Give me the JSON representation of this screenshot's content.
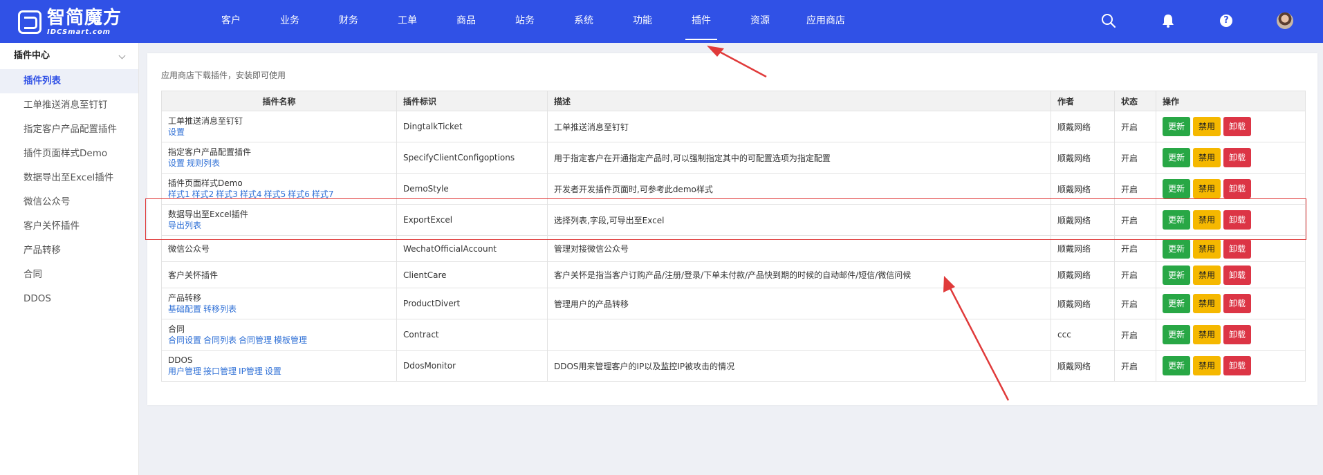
{
  "brand": {
    "name_cn": "智简魔方",
    "name_en": "IDCSmart.com"
  },
  "nav": [
    "客户",
    "业务",
    "财务",
    "工单",
    "商品",
    "站务",
    "系统",
    "功能",
    "插件",
    "资源",
    "应用商店"
  ],
  "nav_active": "插件",
  "header_icons": [
    "search-icon",
    "bell-icon",
    "help-icon",
    "avatar"
  ],
  "help_glyph": "?",
  "sidebar": {
    "group": "插件中心",
    "items": [
      "插件列表",
      "工单推送消息至钉钉",
      "指定客户产品配置插件",
      "插件页面样式Demo",
      "数据导出至Excel插件",
      "微信公众号",
      "客户关怀插件",
      "产品转移",
      "合同",
      "DDOS"
    ],
    "active": "插件列表"
  },
  "hint": "应用商店下载插件，安装即可使用",
  "table": {
    "headers": [
      "插件名称",
      "插件标识",
      "描述",
      "作者",
      "状态",
      "操作"
    ],
    "actions": {
      "update": "更新",
      "disable": "禁用",
      "uninstall": "卸载"
    },
    "rows": [
      {
        "name": "工单推送消息至钉钉",
        "links": [
          "设置"
        ],
        "id": "DingtalkTicket",
        "desc": "工单推送消息至钉钉",
        "author": "顺戴网络",
        "status": "开启"
      },
      {
        "name": "指定客户产品配置插件",
        "links": [
          "设置",
          "规则列表"
        ],
        "id": "SpecifyClientConfigoptions",
        "desc": "用于指定客户在开通指定产品时,可以强制指定其中的可配置选项为指定配置",
        "author": "顺戴网络",
        "status": "开启"
      },
      {
        "name": "插件页面样式Demo",
        "links": [
          "样式1",
          "样式2",
          "样式3",
          "样式4",
          "样式5",
          "样式6",
          "样式7"
        ],
        "id": "DemoStyle",
        "desc": "开发者开发插件页面时,可参考此demo样式",
        "author": "顺戴网络",
        "status": "开启"
      },
      {
        "name": "数据导出至Excel插件",
        "links": [
          "导出列表"
        ],
        "id": "ExportExcel",
        "desc": "选择列表,字段,可导出至Excel",
        "author": "顺戴网络",
        "status": "开启"
      },
      {
        "name": "微信公众号",
        "links": [],
        "id": "WechatOfficialAccount",
        "desc": "管理对接微信公众号",
        "author": "顺戴网络",
        "status": "开启"
      },
      {
        "name": "客户关怀插件",
        "links": [],
        "id": "ClientCare",
        "desc": "客户关怀是指当客户订购产品/注册/登录/下单未付款/产品快到期的时候的自动邮件/短信/微信问候",
        "author": "顺戴网络",
        "status": "开启"
      },
      {
        "name": "产品转移",
        "links": [
          "基础配置",
          "转移列表"
        ],
        "id": "ProductDivert",
        "desc": "管理用户的产品转移",
        "author": "顺戴网络",
        "status": "开启"
      },
      {
        "name": "合同",
        "links": [
          "合同设置",
          "合同列表",
          "合同管理",
          "模板管理"
        ],
        "id": "Contract",
        "desc": "",
        "author": "ccc",
        "status": "开启"
      },
      {
        "name": "DDOS",
        "links": [
          "用户管理",
          "接口管理",
          "IP管理",
          "设置"
        ],
        "id": "DdosMonitor",
        "desc": "DDOS用来管理客户的IP以及监控IP被攻击的情况",
        "author": "顺戴网络",
        "status": "开启"
      }
    ]
  },
  "colors": {
    "primary": "#3051e6",
    "update": "#28a745",
    "disable": "#f5b800",
    "uninstall": "#dc3545",
    "annotation": "#e03a3a"
  }
}
